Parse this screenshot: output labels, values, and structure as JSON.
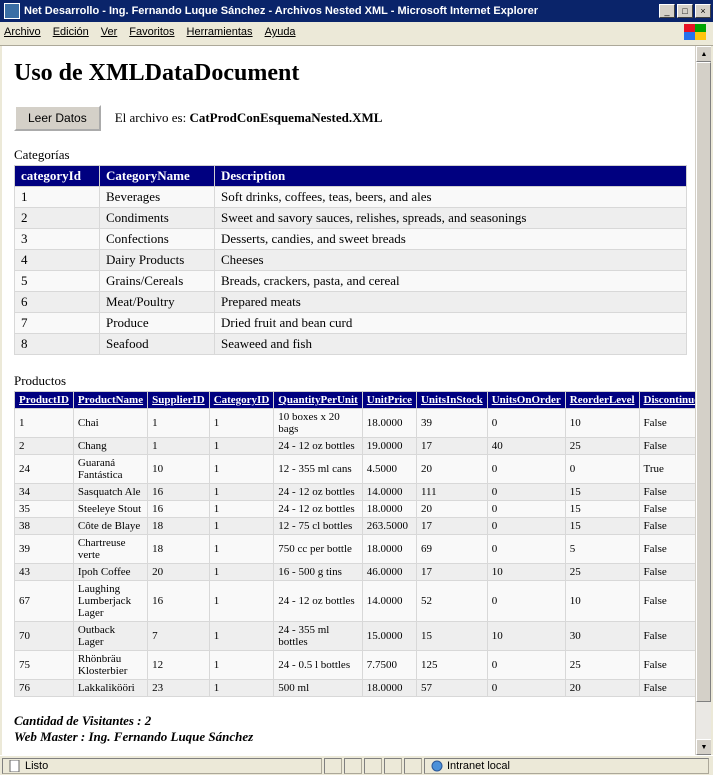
{
  "window": {
    "title": "Net Desarrollo - Ing. Fernando Luque Sánchez - Archivos Nested XML - Microsoft Internet Explorer",
    "min": "_",
    "max": "□",
    "close": "×"
  },
  "menu": {
    "items": [
      "Archivo",
      "Edición",
      "Ver",
      "Favoritos",
      "Herramientas",
      "Ayuda"
    ]
  },
  "page": {
    "heading": "Uso de XMLDataDocument",
    "read_button": "Leer Datos",
    "file_label": "El archivo es: ",
    "file_name": "CatProdConEsquemaNested.XML",
    "categories_label": "Categorías",
    "products_label": "Productos",
    "visitors_label": "Cantidad de Visitantes : 2",
    "webmaster_label": "Web Master : Ing. Fernando Luque Sánchez"
  },
  "cat_headers": [
    "categoryId",
    "CategoryName",
    "Description"
  ],
  "categories": [
    {
      "id": "1",
      "name": "Beverages",
      "desc": "Soft drinks, coffees, teas, beers, and ales"
    },
    {
      "id": "2",
      "name": "Condiments",
      "desc": "Sweet and savory sauces, relishes, spreads, and seasonings"
    },
    {
      "id": "3",
      "name": "Confections",
      "desc": "Desserts, candies, and sweet breads"
    },
    {
      "id": "4",
      "name": "Dairy Products",
      "desc": "Cheeses"
    },
    {
      "id": "5",
      "name": "Grains/Cereals",
      "desc": "Breads, crackers, pasta, and cereal"
    },
    {
      "id": "6",
      "name": "Meat/Poultry",
      "desc": "Prepared meats"
    },
    {
      "id": "7",
      "name": "Produce",
      "desc": "Dried fruit and bean curd"
    },
    {
      "id": "8",
      "name": "Seafood",
      "desc": "Seaweed and fish"
    }
  ],
  "prod_headers": [
    "ProductID",
    "ProductName",
    "SupplierID",
    "CategoryID",
    "QuantityPerUnit",
    "UnitPrice",
    "UnitsInStock",
    "UnitsOnOrder",
    "ReorderLevel",
    "Discontinued"
  ],
  "products": [
    {
      "pid": "1",
      "pname": "Chai",
      "sid": "1",
      "cid": "1",
      "qpu": "10 boxes x 20 bags",
      "price": "18.0000",
      "instock": "39",
      "onorder": "0",
      "reorder": "10",
      "disc": "False"
    },
    {
      "pid": "2",
      "pname": "Chang",
      "sid": "1",
      "cid": "1",
      "qpu": "24 - 12 oz bottles",
      "price": "19.0000",
      "instock": "17",
      "onorder": "40",
      "reorder": "25",
      "disc": "False"
    },
    {
      "pid": "24",
      "pname": "Guaraná Fantástica",
      "sid": "10",
      "cid": "1",
      "qpu": "12 - 355 ml cans",
      "price": "4.5000",
      "instock": "20",
      "onorder": "0",
      "reorder": "0",
      "disc": "True"
    },
    {
      "pid": "34",
      "pname": "Sasquatch Ale",
      "sid": "16",
      "cid": "1",
      "qpu": "24 - 12 oz bottles",
      "price": "14.0000",
      "instock": "111",
      "onorder": "0",
      "reorder": "15",
      "disc": "False"
    },
    {
      "pid": "35",
      "pname": "Steeleye Stout",
      "sid": "16",
      "cid": "1",
      "qpu": "24 - 12 oz bottles",
      "price": "18.0000",
      "instock": "20",
      "onorder": "0",
      "reorder": "15",
      "disc": "False"
    },
    {
      "pid": "38",
      "pname": "Côte de Blaye",
      "sid": "18",
      "cid": "1",
      "qpu": "12 - 75 cl bottles",
      "price": "263.5000",
      "instock": "17",
      "onorder": "0",
      "reorder": "15",
      "disc": "False"
    },
    {
      "pid": "39",
      "pname": "Chartreuse verte",
      "sid": "18",
      "cid": "1",
      "qpu": "750 cc per bottle",
      "price": "18.0000",
      "instock": "69",
      "onorder": "0",
      "reorder": "5",
      "disc": "False"
    },
    {
      "pid": "43",
      "pname": "Ipoh Coffee",
      "sid": "20",
      "cid": "1",
      "qpu": "16 - 500 g tins",
      "price": "46.0000",
      "instock": "17",
      "onorder": "10",
      "reorder": "25",
      "disc": "False"
    },
    {
      "pid": "67",
      "pname": "Laughing Lumberjack Lager",
      "sid": "16",
      "cid": "1",
      "qpu": "24 - 12 oz bottles",
      "price": "14.0000",
      "instock": "52",
      "onorder": "0",
      "reorder": "10",
      "disc": "False"
    },
    {
      "pid": "70",
      "pname": "Outback Lager",
      "sid": "7",
      "cid": "1",
      "qpu": "24 - 355 ml bottles",
      "price": "15.0000",
      "instock": "15",
      "onorder": "10",
      "reorder": "30",
      "disc": "False"
    },
    {
      "pid": "75",
      "pname": "Rhönbräu Klosterbier",
      "sid": "12",
      "cid": "1",
      "qpu": "24 - 0.5 l bottles",
      "price": "7.7500",
      "instock": "125",
      "onorder": "0",
      "reorder": "25",
      "disc": "False"
    },
    {
      "pid": "76",
      "pname": "Lakkalikööri",
      "sid": "23",
      "cid": "1",
      "qpu": "500 ml",
      "price": "18.0000",
      "instock": "57",
      "onorder": "0",
      "reorder": "20",
      "disc": "False"
    }
  ],
  "status": {
    "left": "Listo",
    "right": "Intranet local"
  }
}
